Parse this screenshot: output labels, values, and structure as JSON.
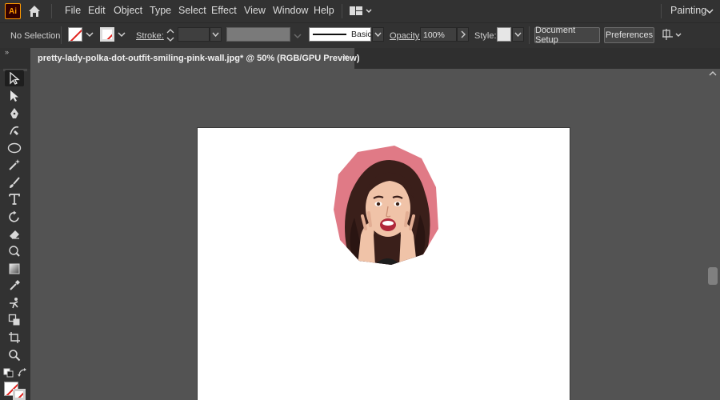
{
  "app": {
    "logo_text": "Ai",
    "workspace": "Painting"
  },
  "menu": {
    "items": [
      "File",
      "Edit",
      "Object",
      "Type",
      "Select",
      "Effect",
      "View",
      "Window",
      "Help"
    ]
  },
  "control_bar": {
    "selection_label": "No Selection",
    "stroke_label": "Stroke:",
    "brush_label": "Basic",
    "opacity_label": "Opacity:",
    "opacity_value": "100%",
    "style_label": "Style:",
    "document_setup": "Document Setup",
    "preferences": "Preferences"
  },
  "document": {
    "tab_title": "pretty-lady-polka-dot-outfit-smiling-pink-wall.jpg* @ 50% (RGB/GPU Preview)",
    "close_glyph": "×"
  },
  "colors": {
    "ui_dark": "#323232",
    "canvas_bg": "#535353",
    "artboard": "#ffffff",
    "photo_pink": "#e07a86",
    "none_slash": "#e0201b"
  },
  "tools": [
    "selection-tool-icon",
    "direct-selection-tool-icon",
    "pen-tool-icon",
    "curvature-tool-icon",
    "ellipse-tool-icon",
    "magic-wand-icon",
    "paintbrush-icon",
    "type-tool-icon",
    "rotate-tool-icon",
    "eraser-tool-icon",
    "warp-tool-icon",
    "gradient-tool-icon",
    "eyedropper-tool-icon",
    "puppet-warp-icon",
    "shape-builder-icon",
    "artboard-tool-icon",
    "zoom-tool-icon"
  ]
}
